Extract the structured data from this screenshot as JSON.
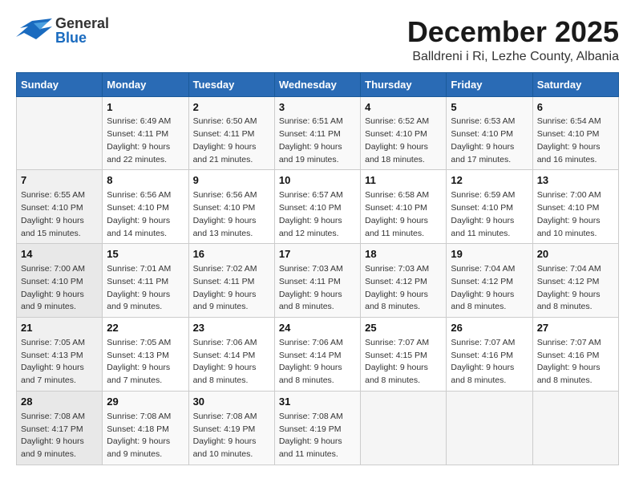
{
  "header": {
    "logo_general": "General",
    "logo_blue": "Blue",
    "month": "December 2025",
    "location": "Balldreni i Ri, Lezhe County, Albania"
  },
  "days_of_week": [
    "Sunday",
    "Monday",
    "Tuesday",
    "Wednesday",
    "Thursday",
    "Friday",
    "Saturday"
  ],
  "weeks": [
    [
      {
        "day": "",
        "info": ""
      },
      {
        "day": "1",
        "info": "Sunrise: 6:49 AM\nSunset: 4:11 PM\nDaylight: 9 hours\nand 22 minutes."
      },
      {
        "day": "2",
        "info": "Sunrise: 6:50 AM\nSunset: 4:11 PM\nDaylight: 9 hours\nand 21 minutes."
      },
      {
        "day": "3",
        "info": "Sunrise: 6:51 AM\nSunset: 4:11 PM\nDaylight: 9 hours\nand 19 minutes."
      },
      {
        "day": "4",
        "info": "Sunrise: 6:52 AM\nSunset: 4:10 PM\nDaylight: 9 hours\nand 18 minutes."
      },
      {
        "day": "5",
        "info": "Sunrise: 6:53 AM\nSunset: 4:10 PM\nDaylight: 9 hours\nand 17 minutes."
      },
      {
        "day": "6",
        "info": "Sunrise: 6:54 AM\nSunset: 4:10 PM\nDaylight: 9 hours\nand 16 minutes."
      }
    ],
    [
      {
        "day": "7",
        "info": "Sunrise: 6:55 AM\nSunset: 4:10 PM\nDaylight: 9 hours\nand 15 minutes."
      },
      {
        "day": "8",
        "info": "Sunrise: 6:56 AM\nSunset: 4:10 PM\nDaylight: 9 hours\nand 14 minutes."
      },
      {
        "day": "9",
        "info": "Sunrise: 6:56 AM\nSunset: 4:10 PM\nDaylight: 9 hours\nand 13 minutes."
      },
      {
        "day": "10",
        "info": "Sunrise: 6:57 AM\nSunset: 4:10 PM\nDaylight: 9 hours\nand 12 minutes."
      },
      {
        "day": "11",
        "info": "Sunrise: 6:58 AM\nSunset: 4:10 PM\nDaylight: 9 hours\nand 11 minutes."
      },
      {
        "day": "12",
        "info": "Sunrise: 6:59 AM\nSunset: 4:10 PM\nDaylight: 9 hours\nand 11 minutes."
      },
      {
        "day": "13",
        "info": "Sunrise: 7:00 AM\nSunset: 4:10 PM\nDaylight: 9 hours\nand 10 minutes."
      }
    ],
    [
      {
        "day": "14",
        "info": "Sunrise: 7:00 AM\nSunset: 4:10 PM\nDaylight: 9 hours\nand 9 minutes."
      },
      {
        "day": "15",
        "info": "Sunrise: 7:01 AM\nSunset: 4:11 PM\nDaylight: 9 hours\nand 9 minutes."
      },
      {
        "day": "16",
        "info": "Sunrise: 7:02 AM\nSunset: 4:11 PM\nDaylight: 9 hours\nand 9 minutes."
      },
      {
        "day": "17",
        "info": "Sunrise: 7:03 AM\nSunset: 4:11 PM\nDaylight: 9 hours\nand 8 minutes."
      },
      {
        "day": "18",
        "info": "Sunrise: 7:03 AM\nSunset: 4:12 PM\nDaylight: 9 hours\nand 8 minutes."
      },
      {
        "day": "19",
        "info": "Sunrise: 7:04 AM\nSunset: 4:12 PM\nDaylight: 9 hours\nand 8 minutes."
      },
      {
        "day": "20",
        "info": "Sunrise: 7:04 AM\nSunset: 4:12 PM\nDaylight: 9 hours\nand 8 minutes."
      }
    ],
    [
      {
        "day": "21",
        "info": "Sunrise: 7:05 AM\nSunset: 4:13 PM\nDaylight: 9 hours\nand 7 minutes."
      },
      {
        "day": "22",
        "info": "Sunrise: 7:05 AM\nSunset: 4:13 PM\nDaylight: 9 hours\nand 7 minutes."
      },
      {
        "day": "23",
        "info": "Sunrise: 7:06 AM\nSunset: 4:14 PM\nDaylight: 9 hours\nand 8 minutes."
      },
      {
        "day": "24",
        "info": "Sunrise: 7:06 AM\nSunset: 4:14 PM\nDaylight: 9 hours\nand 8 minutes."
      },
      {
        "day": "25",
        "info": "Sunrise: 7:07 AM\nSunset: 4:15 PM\nDaylight: 9 hours\nand 8 minutes."
      },
      {
        "day": "26",
        "info": "Sunrise: 7:07 AM\nSunset: 4:16 PM\nDaylight: 9 hours\nand 8 minutes."
      },
      {
        "day": "27",
        "info": "Sunrise: 7:07 AM\nSunset: 4:16 PM\nDaylight: 9 hours\nand 8 minutes."
      }
    ],
    [
      {
        "day": "28",
        "info": "Sunrise: 7:08 AM\nSunset: 4:17 PM\nDaylight: 9 hours\nand 9 minutes."
      },
      {
        "day": "29",
        "info": "Sunrise: 7:08 AM\nSunset: 4:18 PM\nDaylight: 9 hours\nand 9 minutes."
      },
      {
        "day": "30",
        "info": "Sunrise: 7:08 AM\nSunset: 4:19 PM\nDaylight: 9 hours\nand 10 minutes."
      },
      {
        "day": "31",
        "info": "Sunrise: 7:08 AM\nSunset: 4:19 PM\nDaylight: 9 hours\nand 11 minutes."
      },
      {
        "day": "",
        "info": ""
      },
      {
        "day": "",
        "info": ""
      },
      {
        "day": "",
        "info": ""
      }
    ]
  ]
}
